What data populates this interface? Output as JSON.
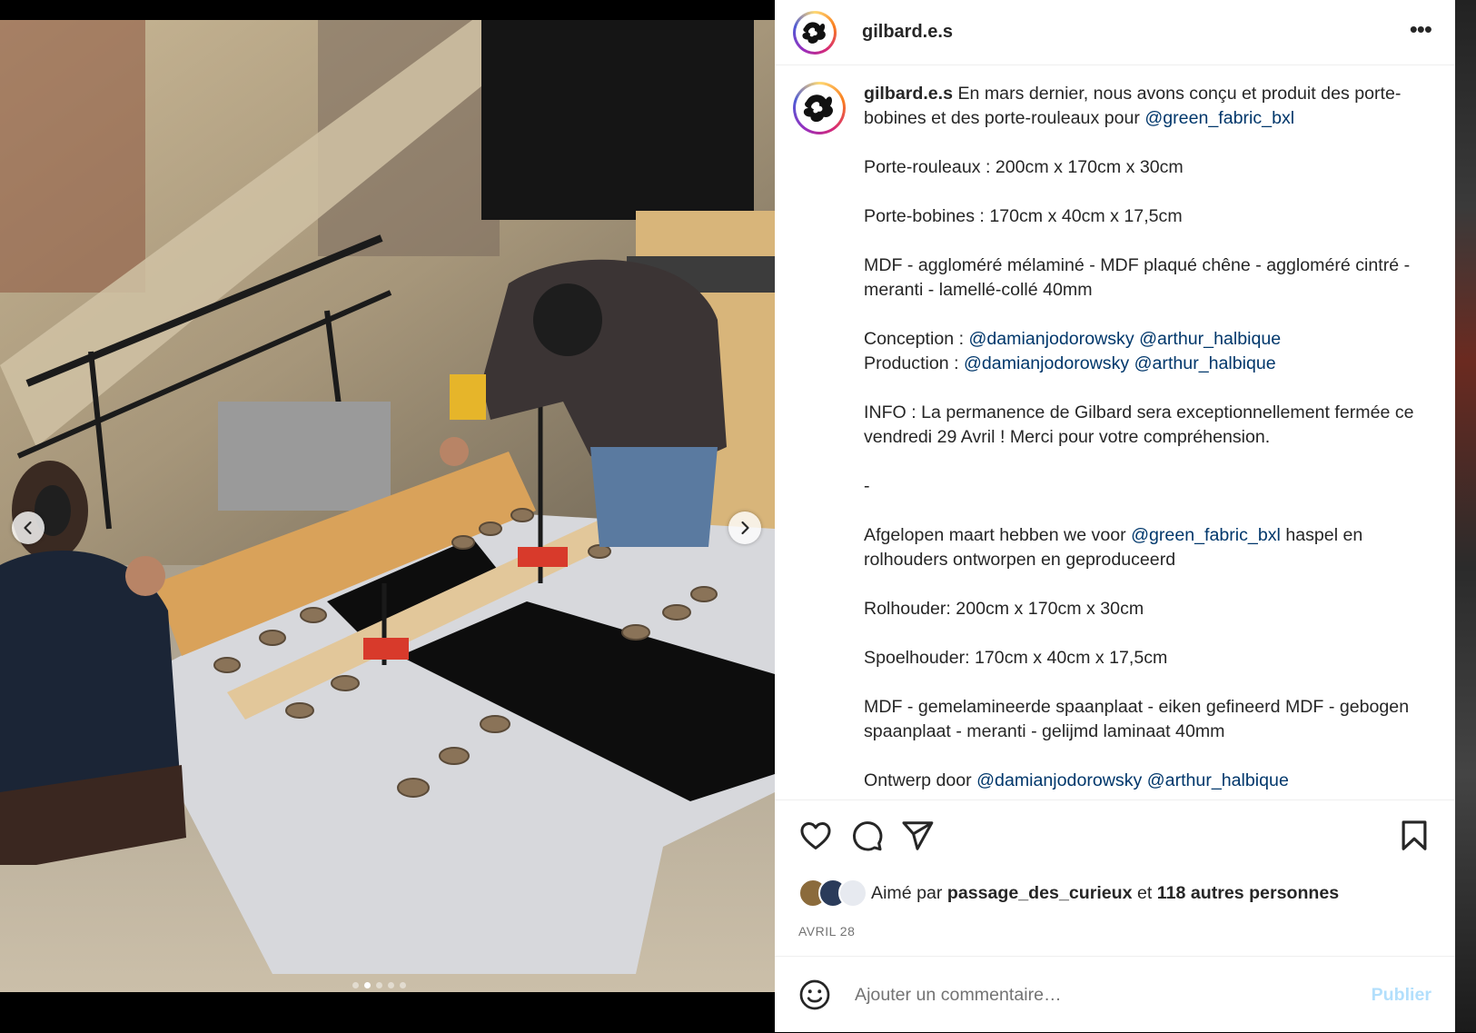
{
  "post": {
    "username": "gilbard.e.s",
    "more_icon": "more-horizontal-icon",
    "carousel": {
      "count": 5,
      "active": 1
    }
  },
  "caption": {
    "username": "gilbard.e.s",
    "paragraphs": [
      [
        {
          "t": "En mars dernier, nous avons conçu et produit des porte-bobines et des porte-rouleaux pour "
        },
        {
          "t": "@green_fabric_bxl",
          "m": true
        }
      ],
      [
        {
          "t": "Porte-rouleaux : 200cm x 170cm x 30cm"
        }
      ],
      [
        {
          "t": "Porte-bobines : 170cm x 40cm x 17,5cm"
        }
      ],
      [
        {
          "t": "MDF - aggloméré mélaminé - MDF plaqué chêne - aggloméré cintré - meranti - lamellé-collé 40mm"
        }
      ],
      [
        {
          "t": "Conception : "
        },
        {
          "t": "@damianjodorowsky",
          "m": true
        },
        {
          "t": " "
        },
        {
          "t": "@arthur_halbique",
          "m": true
        },
        {
          "t": "\nProduction : "
        },
        {
          "t": "@damianjodorowsky",
          "m": true
        },
        {
          "t": " "
        },
        {
          "t": "@arthur_halbique",
          "m": true
        }
      ],
      [
        {
          "t": "INFO : La permanence de Gilbard sera exceptionnellement fermée ce vendredi 29 Avril ! Merci pour votre compréhension."
        }
      ],
      [
        {
          "t": "-"
        }
      ],
      [
        {
          "t": "Afgelopen maart hebben we voor "
        },
        {
          "t": "@green_fabric_bxl",
          "m": true
        },
        {
          "t": " haspel en rolhouders ontworpen en geproduceerd"
        }
      ],
      [
        {
          "t": "Rolhouder: 200cm x 170cm x 30cm"
        }
      ],
      [
        {
          "t": "Spoelhouder: 170cm x 40cm x 17,5cm"
        }
      ],
      [
        {
          "t": "MDF - gemelamineerde spaanplaat - eiken gefineerd MDF - gebogen spaanplaat - meranti - gelijmd laminaat 40mm"
        }
      ],
      [
        {
          "t": "Ontwerp door "
        },
        {
          "t": "@damianjodorowsky",
          "m": true
        },
        {
          "t": " "
        },
        {
          "t": "@arthur_halbique",
          "m": true
        }
      ]
    ]
  },
  "actions": {
    "like_icon": "heart-icon",
    "comment_icon": "comment-icon",
    "share_icon": "send-icon",
    "save_icon": "bookmark-icon"
  },
  "likes": {
    "prefix": "Aimé par ",
    "user": "passage_des_curieux",
    "middle": " et ",
    "others": "118 autres personnes"
  },
  "date": "AVRIL 28",
  "comment": {
    "placeholder": "Ajouter un commentaire…",
    "publish": "Publier",
    "emoji_icon": "emoji-icon"
  },
  "colors": {
    "mention": "#00376b",
    "publish_disabled": "#b2dffc",
    "secondary": "#737373"
  }
}
